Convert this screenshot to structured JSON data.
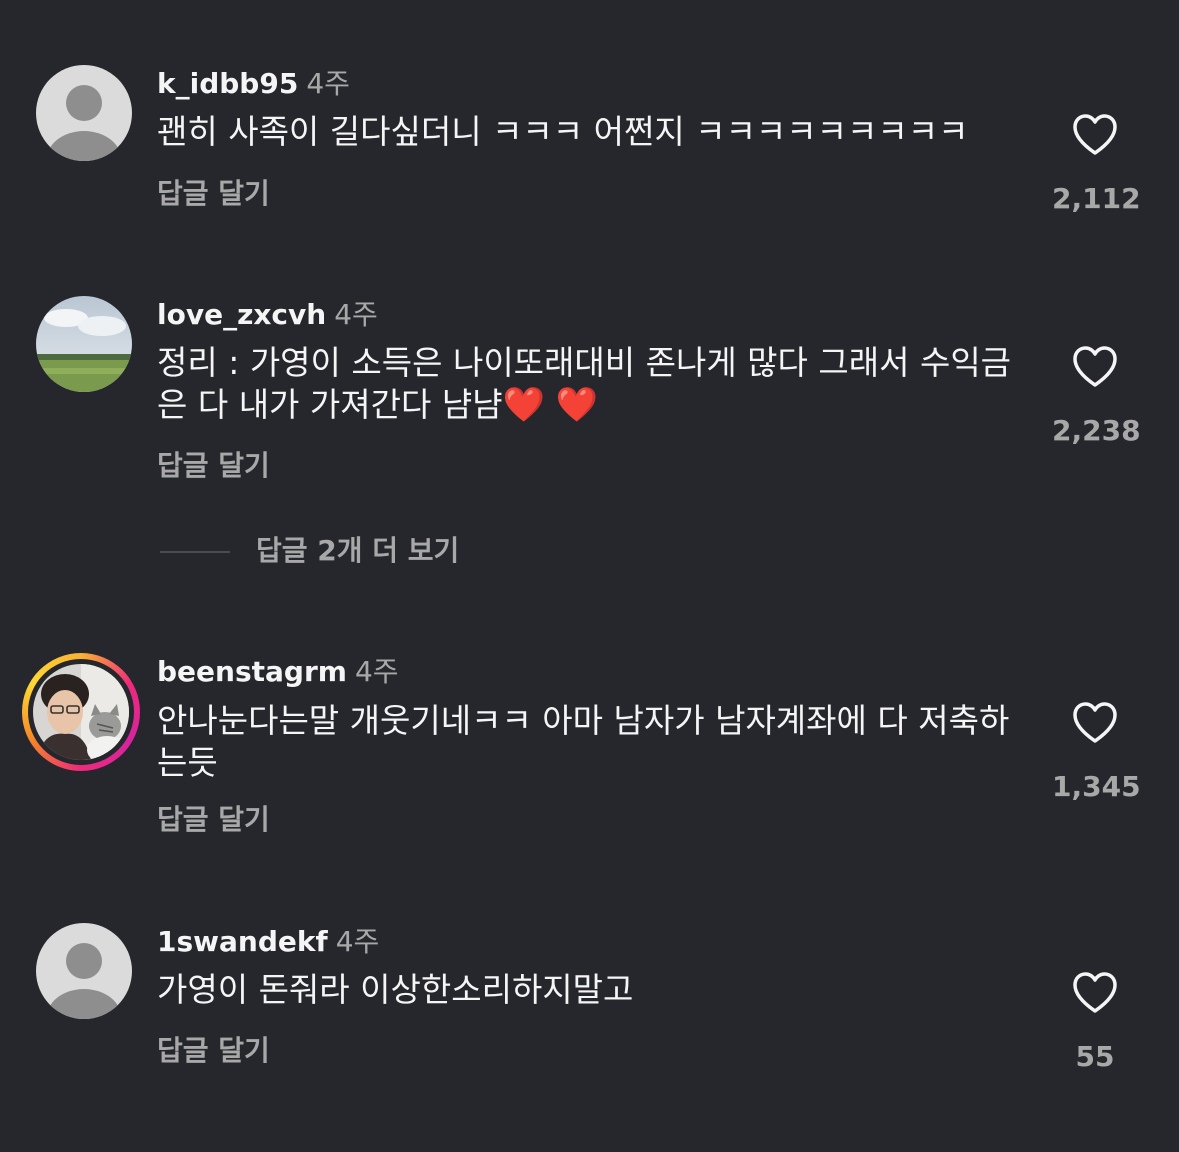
{
  "comments": [
    {
      "username": "k_idbb95",
      "time": "4주",
      "text": "괜히 사족이 길다싶더니 ㅋㅋㅋ 어쩐지 ㅋㅋㅋㅋㅋㅋㅋㅋㅋ",
      "reply_label": "답글 달기",
      "likes": "2,112",
      "avatar": "default-avatar-icon"
    },
    {
      "username": "love_zxcvh",
      "time": "4주",
      "text": "정리 : 가영이 소득은 나이또래대비 존나게 많다 그래서 수익금은 다 내가 가져간다 냠냠",
      "emoji": "❤️ ❤️",
      "reply_label": "답글 달기",
      "likes": "2,238",
      "avatar": "landscape-photo"
    },
    {
      "username": "beenstagrm",
      "time": "4주",
      "text": "안나눈다는말 개웃기네ㅋㅋ 아마 남자가 남자계좌에 다 저축하는듯",
      "reply_label": "답글 달기",
      "likes": "1,345",
      "avatar": "person-with-cat-photo"
    },
    {
      "username": "1swandekf",
      "time": "4주",
      "text": "가영이 돈줘라 이상한소리하지말고",
      "reply_label": "답글 달기",
      "likes": "55",
      "avatar": "default-avatar-icon"
    }
  ],
  "more_replies": "답글 2개 더 보기",
  "colors": {
    "background": "#25272c",
    "primary_text": "#f5f5f5",
    "secondary_text": "#a8a8a8",
    "heart_outline": "#f5f5f5"
  }
}
